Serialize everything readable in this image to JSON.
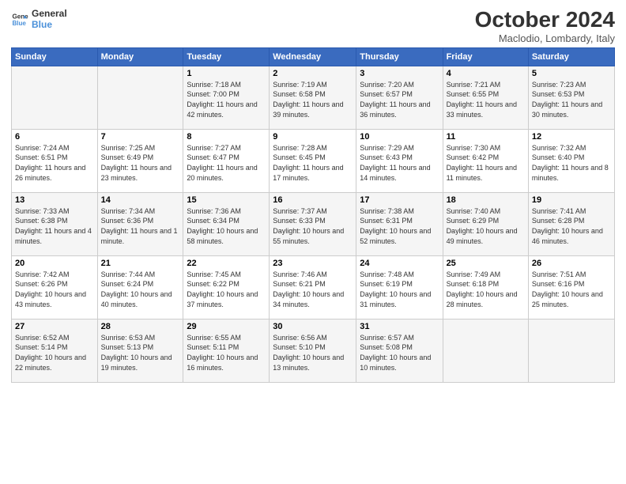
{
  "logo": {
    "line1": "General",
    "line2": "Blue"
  },
  "title": "October 2024",
  "subtitle": "Maclodio, Lombardy, Italy",
  "days_header": [
    "Sunday",
    "Monday",
    "Tuesday",
    "Wednesday",
    "Thursday",
    "Friday",
    "Saturday"
  ],
  "weeks": [
    [
      {
        "day": "",
        "sunrise": "",
        "sunset": "",
        "daylight": ""
      },
      {
        "day": "",
        "sunrise": "",
        "sunset": "",
        "daylight": ""
      },
      {
        "day": "1",
        "sunrise": "Sunrise: 7:18 AM",
        "sunset": "Sunset: 7:00 PM",
        "daylight": "Daylight: 11 hours and 42 minutes."
      },
      {
        "day": "2",
        "sunrise": "Sunrise: 7:19 AM",
        "sunset": "Sunset: 6:58 PM",
        "daylight": "Daylight: 11 hours and 39 minutes."
      },
      {
        "day": "3",
        "sunrise": "Sunrise: 7:20 AM",
        "sunset": "Sunset: 6:57 PM",
        "daylight": "Daylight: 11 hours and 36 minutes."
      },
      {
        "day": "4",
        "sunrise": "Sunrise: 7:21 AM",
        "sunset": "Sunset: 6:55 PM",
        "daylight": "Daylight: 11 hours and 33 minutes."
      },
      {
        "day": "5",
        "sunrise": "Sunrise: 7:23 AM",
        "sunset": "Sunset: 6:53 PM",
        "daylight": "Daylight: 11 hours and 30 minutes."
      }
    ],
    [
      {
        "day": "6",
        "sunrise": "Sunrise: 7:24 AM",
        "sunset": "Sunset: 6:51 PM",
        "daylight": "Daylight: 11 hours and 26 minutes."
      },
      {
        "day": "7",
        "sunrise": "Sunrise: 7:25 AM",
        "sunset": "Sunset: 6:49 PM",
        "daylight": "Daylight: 11 hours and 23 minutes."
      },
      {
        "day": "8",
        "sunrise": "Sunrise: 7:27 AM",
        "sunset": "Sunset: 6:47 PM",
        "daylight": "Daylight: 11 hours and 20 minutes."
      },
      {
        "day": "9",
        "sunrise": "Sunrise: 7:28 AM",
        "sunset": "Sunset: 6:45 PM",
        "daylight": "Daylight: 11 hours and 17 minutes."
      },
      {
        "day": "10",
        "sunrise": "Sunrise: 7:29 AM",
        "sunset": "Sunset: 6:43 PM",
        "daylight": "Daylight: 11 hours and 14 minutes."
      },
      {
        "day": "11",
        "sunrise": "Sunrise: 7:30 AM",
        "sunset": "Sunset: 6:42 PM",
        "daylight": "Daylight: 11 hours and 11 minutes."
      },
      {
        "day": "12",
        "sunrise": "Sunrise: 7:32 AM",
        "sunset": "Sunset: 6:40 PM",
        "daylight": "Daylight: 11 hours and 8 minutes."
      }
    ],
    [
      {
        "day": "13",
        "sunrise": "Sunrise: 7:33 AM",
        "sunset": "Sunset: 6:38 PM",
        "daylight": "Daylight: 11 hours and 4 minutes."
      },
      {
        "day": "14",
        "sunrise": "Sunrise: 7:34 AM",
        "sunset": "Sunset: 6:36 PM",
        "daylight": "Daylight: 11 hours and 1 minute."
      },
      {
        "day": "15",
        "sunrise": "Sunrise: 7:36 AM",
        "sunset": "Sunset: 6:34 PM",
        "daylight": "Daylight: 10 hours and 58 minutes."
      },
      {
        "day": "16",
        "sunrise": "Sunrise: 7:37 AM",
        "sunset": "Sunset: 6:33 PM",
        "daylight": "Daylight: 10 hours and 55 minutes."
      },
      {
        "day": "17",
        "sunrise": "Sunrise: 7:38 AM",
        "sunset": "Sunset: 6:31 PM",
        "daylight": "Daylight: 10 hours and 52 minutes."
      },
      {
        "day": "18",
        "sunrise": "Sunrise: 7:40 AM",
        "sunset": "Sunset: 6:29 PM",
        "daylight": "Daylight: 10 hours and 49 minutes."
      },
      {
        "day": "19",
        "sunrise": "Sunrise: 7:41 AM",
        "sunset": "Sunset: 6:28 PM",
        "daylight": "Daylight: 10 hours and 46 minutes."
      }
    ],
    [
      {
        "day": "20",
        "sunrise": "Sunrise: 7:42 AM",
        "sunset": "Sunset: 6:26 PM",
        "daylight": "Daylight: 10 hours and 43 minutes."
      },
      {
        "day": "21",
        "sunrise": "Sunrise: 7:44 AM",
        "sunset": "Sunset: 6:24 PM",
        "daylight": "Daylight: 10 hours and 40 minutes."
      },
      {
        "day": "22",
        "sunrise": "Sunrise: 7:45 AM",
        "sunset": "Sunset: 6:22 PM",
        "daylight": "Daylight: 10 hours and 37 minutes."
      },
      {
        "day": "23",
        "sunrise": "Sunrise: 7:46 AM",
        "sunset": "Sunset: 6:21 PM",
        "daylight": "Daylight: 10 hours and 34 minutes."
      },
      {
        "day": "24",
        "sunrise": "Sunrise: 7:48 AM",
        "sunset": "Sunset: 6:19 PM",
        "daylight": "Daylight: 10 hours and 31 minutes."
      },
      {
        "day": "25",
        "sunrise": "Sunrise: 7:49 AM",
        "sunset": "Sunset: 6:18 PM",
        "daylight": "Daylight: 10 hours and 28 minutes."
      },
      {
        "day": "26",
        "sunrise": "Sunrise: 7:51 AM",
        "sunset": "Sunset: 6:16 PM",
        "daylight": "Daylight: 10 hours and 25 minutes."
      }
    ],
    [
      {
        "day": "27",
        "sunrise": "Sunrise: 6:52 AM",
        "sunset": "Sunset: 5:14 PM",
        "daylight": "Daylight: 10 hours and 22 minutes."
      },
      {
        "day": "28",
        "sunrise": "Sunrise: 6:53 AM",
        "sunset": "Sunset: 5:13 PM",
        "daylight": "Daylight: 10 hours and 19 minutes."
      },
      {
        "day": "29",
        "sunrise": "Sunrise: 6:55 AM",
        "sunset": "Sunset: 5:11 PM",
        "daylight": "Daylight: 10 hours and 16 minutes."
      },
      {
        "day": "30",
        "sunrise": "Sunrise: 6:56 AM",
        "sunset": "Sunset: 5:10 PM",
        "daylight": "Daylight: 10 hours and 13 minutes."
      },
      {
        "day": "31",
        "sunrise": "Sunrise: 6:57 AM",
        "sunset": "Sunset: 5:08 PM",
        "daylight": "Daylight: 10 hours and 10 minutes."
      },
      {
        "day": "",
        "sunrise": "",
        "sunset": "",
        "daylight": ""
      },
      {
        "day": "",
        "sunrise": "",
        "sunset": "",
        "daylight": ""
      }
    ]
  ]
}
